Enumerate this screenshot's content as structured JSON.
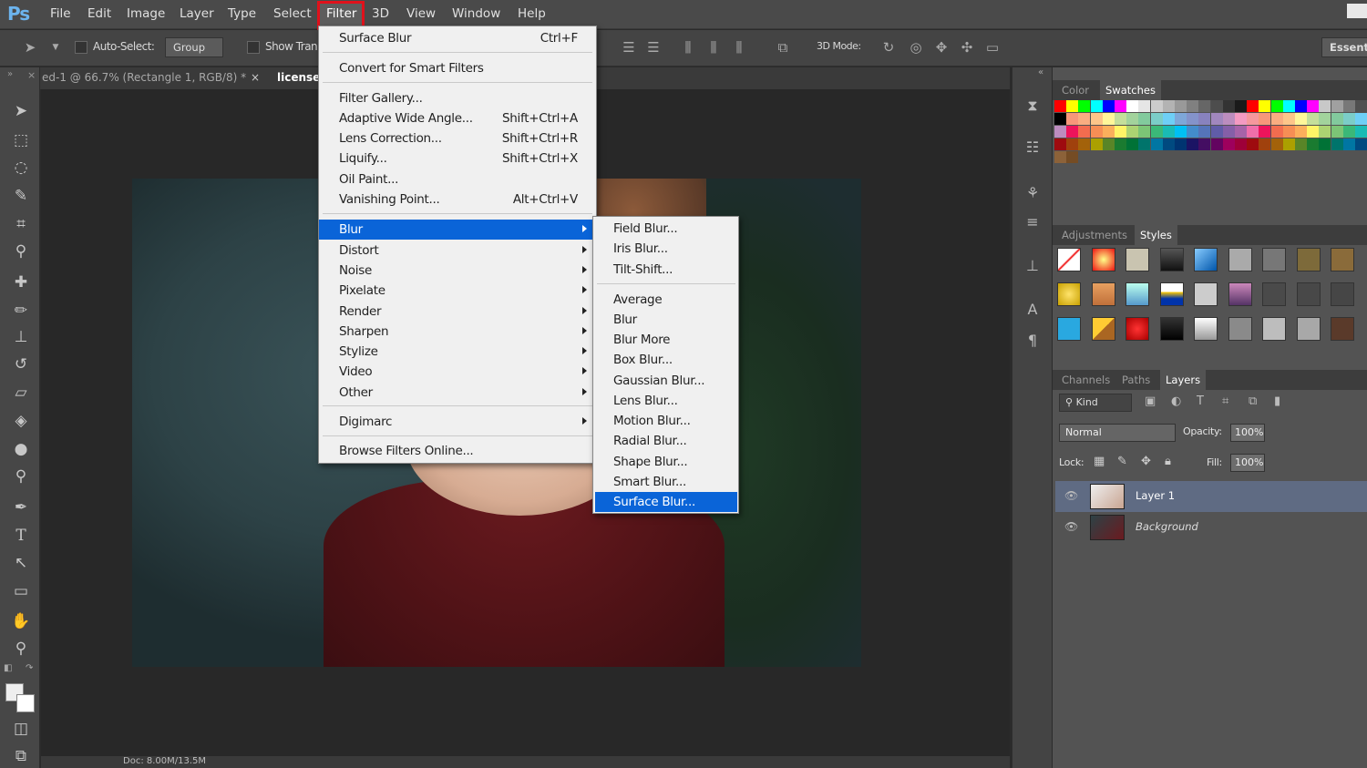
{
  "app": {
    "logo": "Ps"
  },
  "menubar": [
    "File",
    "Edit",
    "Image",
    "Layer",
    "Type",
    "Select",
    "Filter",
    "3D",
    "View",
    "Window",
    "Help"
  ],
  "options": {
    "auto_select": "Auto-Select:",
    "group": "Group",
    "show_transform": "Show Tran",
    "mode_3d": "3D Mode:",
    "workspace": "Essenti"
  },
  "doc_tabs": [
    "ed-1 @ 66.7% (Rectangle 1, RGB/8) *",
    "license"
  ],
  "filter_menu": {
    "last_filter": {
      "label": "Surface Blur",
      "shortcut": "Ctrl+F"
    },
    "smart": "Convert for Smart Filters",
    "group1": [
      {
        "label": "Filter Gallery...",
        "shortcut": ""
      },
      {
        "label": "Adaptive Wide Angle...",
        "shortcut": "Shift+Ctrl+A"
      },
      {
        "label": "Lens Correction...",
        "shortcut": "Shift+Ctrl+R"
      },
      {
        "label": "Liquify...",
        "shortcut": "Shift+Ctrl+X"
      },
      {
        "label": "Oil Paint...",
        "shortcut": ""
      },
      {
        "label": "Vanishing Point...",
        "shortcut": "Alt+Ctrl+V"
      }
    ],
    "group2": [
      "Blur",
      "Distort",
      "Noise",
      "Pixelate",
      "Render",
      "Sharpen",
      "Stylize",
      "Video",
      "Other"
    ],
    "digimarc": "Digimarc",
    "browse": "Browse Filters Online..."
  },
  "blur_submenu": {
    "group1": [
      "Field Blur...",
      "Iris Blur...",
      "Tilt-Shift..."
    ],
    "group2": [
      "Average",
      "Blur",
      "Blur More",
      "Box Blur...",
      "Gaussian Blur...",
      "Lens Blur...",
      "Motion Blur...",
      "Radial Blur...",
      "Shape Blur...",
      "Smart Blur...",
      "Surface Blur..."
    ],
    "highlighted": "Surface Blur..."
  },
  "panels": {
    "color_tabs": [
      "Color",
      "Swatches"
    ],
    "adjust_tabs": [
      "Adjustments",
      "Styles"
    ],
    "layer_tabs": [
      "Channels",
      "Paths",
      "Layers"
    ]
  },
  "layers": {
    "kind": "Kind",
    "blend_mode": "Normal",
    "opacity_label": "Opacity:",
    "opacity": "100%",
    "lock_label": "Lock:",
    "fill_label": "Fill:",
    "fill": "100%",
    "items": [
      {
        "name": "Layer 1"
      },
      {
        "name": "Background"
      }
    ]
  },
  "status": "Doc: 8.00M/13.5M",
  "colors": {
    "highlight": "#0a64d8",
    "annotation": "#e0111b"
  }
}
